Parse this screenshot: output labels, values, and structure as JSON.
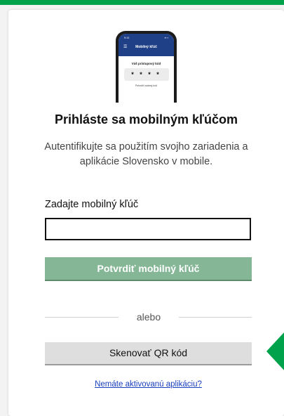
{
  "colors": {
    "accent": "#00a34b",
    "confirm_button": "#85b797",
    "qr_button": "#dedede",
    "link": "#1a3fbf"
  },
  "phone": {
    "time": "9:41",
    "signal": "▪▪ ▪",
    "screen_title": "Mobilný kľúč",
    "subtitle": "Váš prístupový kód",
    "code": "* * * *",
    "footer": "Potvrdiť zadaný kód"
  },
  "login": {
    "title": "Prihláste sa mobilným kľúčom",
    "subtitle": "Autentifikujte sa použitím svojho zariadenia a aplikácie Slovensko v mobile.",
    "field_label": "Zadajte mobilný kľúč",
    "field_value": "",
    "confirm_label": "Potvrdiť mobilný kľúč",
    "divider_text": "alebo",
    "qr_label": "Skenovať QR kód",
    "help_link": "Nemáte aktivovanú aplikáciu?"
  }
}
